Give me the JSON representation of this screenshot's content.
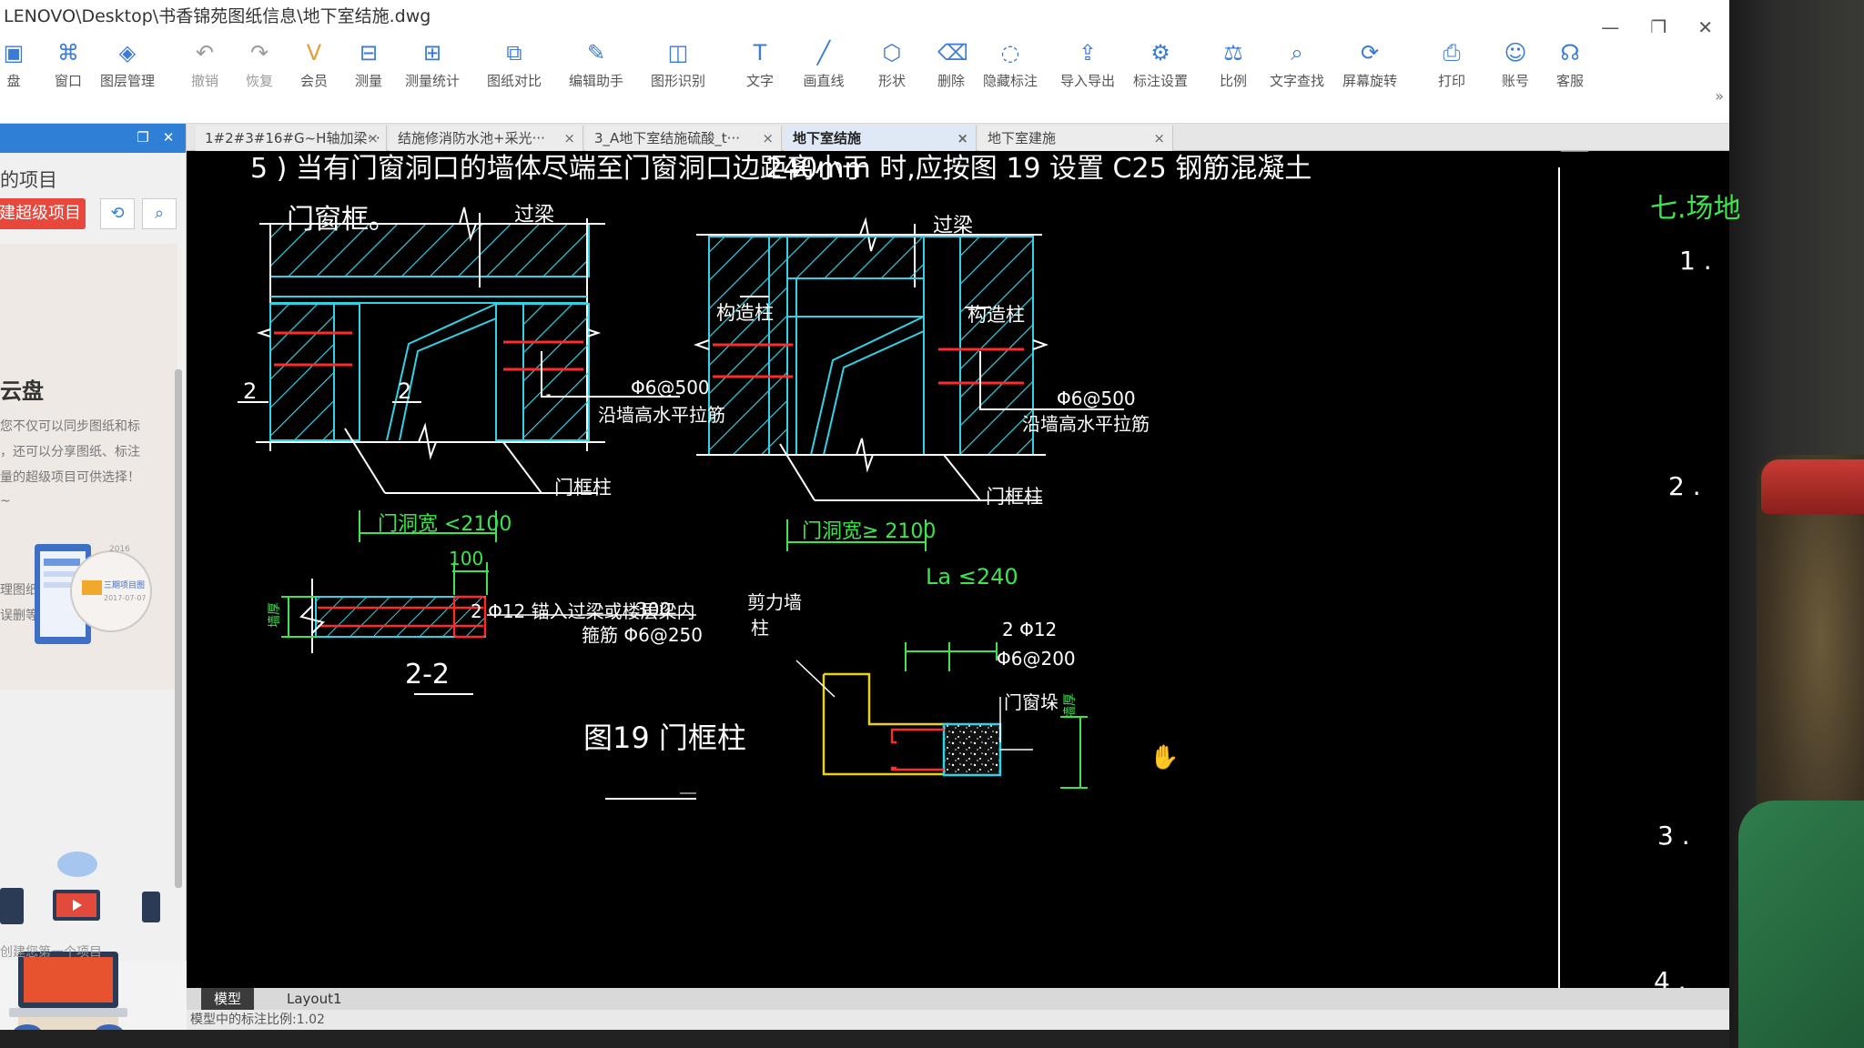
{
  "window": {
    "title": "LENOVO\\Desktop\\书香锦苑图纸信息\\地下室结施.dwg",
    "controls": [
      "—",
      "❐",
      "✕"
    ]
  },
  "toolbar": {
    "items": [
      {
        "label": "盘",
        "icon": "disk-icon"
      },
      {
        "label": "窗口",
        "icon": "window-icon"
      },
      {
        "label": "图层管理",
        "icon": "layers-icon"
      },
      {
        "label": "撤销",
        "icon": "undo-icon"
      },
      {
        "label": "恢复",
        "icon": "redo-icon"
      },
      {
        "label": "会员",
        "icon": "vip-icon"
      },
      {
        "label": "测量",
        "icon": "measure-icon"
      },
      {
        "label": "测量统计",
        "icon": "measure-stats-icon"
      },
      {
        "label": "图纸对比",
        "icon": "compare-icon"
      },
      {
        "label": "编辑助手",
        "icon": "edit-helper-icon"
      },
      {
        "label": "图形识别",
        "icon": "shape-recognize-icon"
      },
      {
        "label": "文字",
        "icon": "text-icon"
      },
      {
        "label": "画直线",
        "icon": "line-icon"
      },
      {
        "label": "形状",
        "icon": "shape-icon"
      },
      {
        "label": "删除",
        "icon": "eraser-icon"
      },
      {
        "label": "隐藏标注",
        "icon": "hide-annotation-icon"
      },
      {
        "label": "导入导出",
        "icon": "import-export-icon"
      },
      {
        "label": "标注设置",
        "icon": "annotation-settings-icon"
      },
      {
        "label": "比例",
        "icon": "scale-icon"
      },
      {
        "label": "文字查找",
        "icon": "text-search-icon"
      },
      {
        "label": "屏幕旋转",
        "icon": "rotate-screen-icon"
      },
      {
        "label": "打印",
        "icon": "print-icon"
      },
      {
        "label": "账号",
        "icon": "account-icon"
      },
      {
        "label": "客服",
        "icon": "support-icon"
      }
    ],
    "more": "»"
  },
  "left_panel": {
    "header_buttons": [
      "❐",
      "✕"
    ],
    "my_projects": "的项目",
    "super_project_button": "建超级项目",
    "cloud_title": "云盘",
    "cloud_desc_1": "您不仅可以同步图纸和标",
    "cloud_desc_2": "，还可以分享图纸、标注",
    "cloud_desc_3": "量的超级项目可供选择！",
    "cloud_desc_4": "~",
    "manage_desc_1": "理图纸和标注，再也无",
    "manage_desc_2": "误删等导致标注丢失的",
    "illus_card_date_1": "2016",
    "illus_card_title": "三期项目图",
    "illus_card_date_2": "2017-07-07",
    "create_first": "创建您第一个项目"
  },
  "tabs": [
    {
      "label": "1#2#3#16#G~H轴加梁···",
      "active": false
    },
    {
      "label": "结施修消防水池+采光···",
      "active": false
    },
    {
      "label": "3_A地下室结施硫酸_t···",
      "active": false
    },
    {
      "label": "地下室结施",
      "active": true
    },
    {
      "label": "地下室建施",
      "active": false
    }
  ],
  "drawing": {
    "note_line1_left": "5 ) 当有门窗洞口的墙体尽端至门窗洞口边距离小于",
    "note_line1_right": "240mm  时,应按图    19  设置  C25  钢筋混凝土",
    "note_line2": "门窗框。",
    "label_lintel_1": "过梁",
    "label_lintel_2": "过梁",
    "label_constr_col_1": "构造柱",
    "label_constr_col_2": "构造柱",
    "label_section_2_left": "2",
    "label_section_2_mid": "2",
    "rebar_1": "Φ6@500",
    "rebar_1_desc": "沿墙高水平拉筋",
    "rebar_2": "Φ6@500",
    "rebar_2_desc": "沿墙高水平拉筋",
    "frame_col_1": "门框柱",
    "frame_col_2": "门框柱",
    "dim_door_lt": "门洞宽 <2100",
    "dim_door_ge": "门洞宽≥ 2100",
    "dim_100": "100",
    "wall_thk_label": "墙厚",
    "sec_rebar_main": "2 Φ12  锚入过梁或楼层梁内",
    "sec_rebar_300": "300",
    "sec_rebar_stirrup": "箍筋  Φ6@250",
    "section_title": "2-2",
    "shear_wall": "剪力墙",
    "shear_wall_2": "柱",
    "dim_la": "La ≤240",
    "det_rebar_main": "2 Φ12",
    "det_rebar_stirrup": "Φ6@200",
    "det_frame": "门窗垛",
    "det_wall_thk": "墙厚",
    "figure_title": "图19   门框柱",
    "right_col_title": "七.场地",
    "right_col_1": "1 .",
    "right_col_2": "2 .",
    "right_col_3": "3 .",
    "right_col_4": "4 ."
  },
  "layout_tabs": [
    {
      "label": "模型",
      "active": true
    },
    {
      "label": "Layout1",
      "active": false
    }
  ],
  "status": {
    "text": "模型中的标注比例:1.02"
  },
  "colors": {
    "cad_background": "#000000",
    "cad_white": "#ffffff",
    "cad_cyan": "#32d2e6",
    "cad_red": "#ff2a2a",
    "cad_green": "#3ee44e",
    "cad_yellow": "#e8d21d",
    "accent_blue": "#2f7fd6",
    "accent_red": "#e8473c"
  }
}
